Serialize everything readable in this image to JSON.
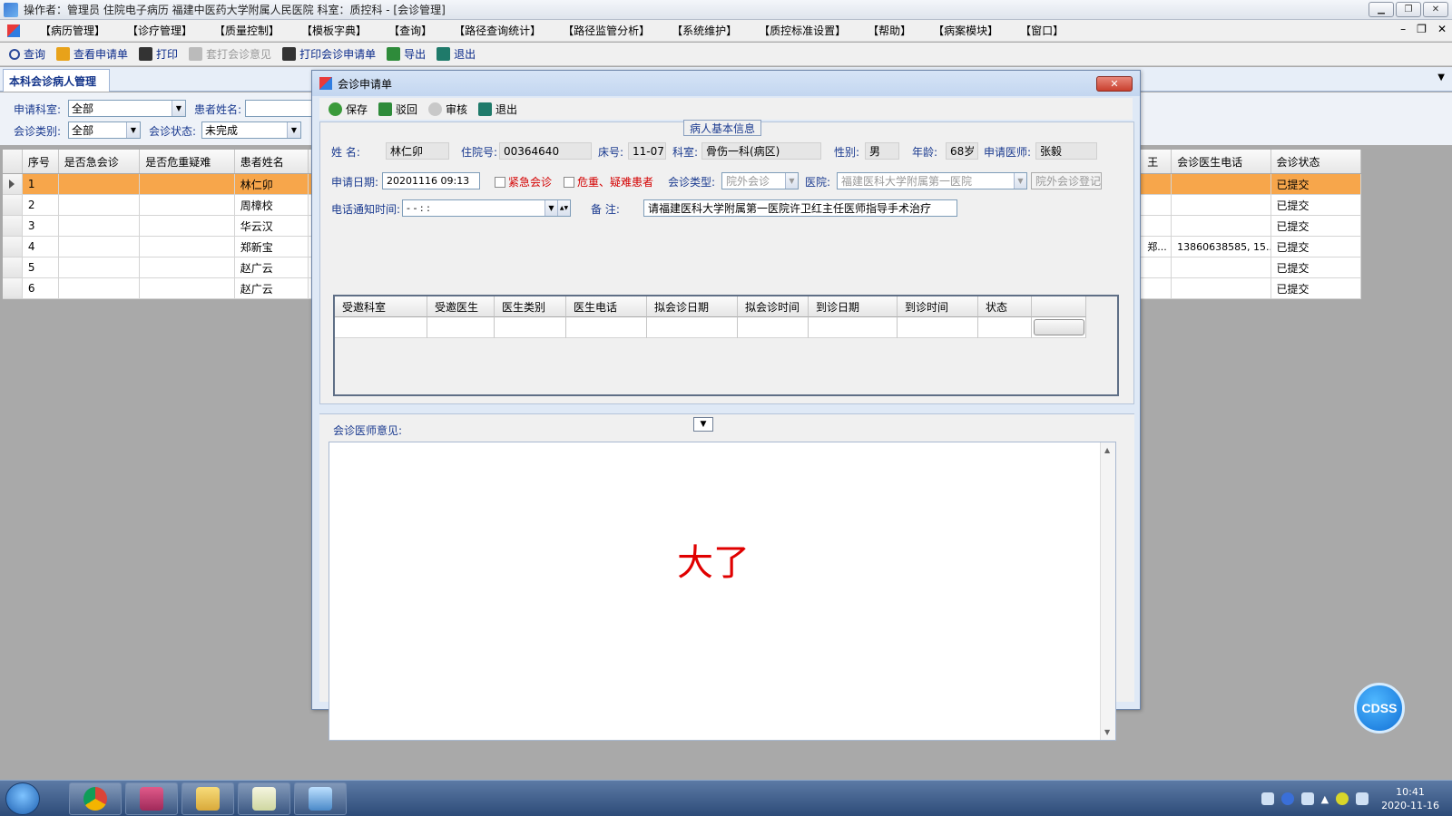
{
  "window": {
    "title": "操作者：管理员 住院电子病历  福建中医药大学附属人民医院  科室：质控科 - [会诊管理]",
    "controls": [
      "▁",
      "❐",
      "✕"
    ]
  },
  "menu": {
    "items": [
      "【病历管理】",
      "【诊疗管理】",
      "【质量控制】",
      "【模板字典】",
      "【查询】",
      "【路径查询统计】",
      "【路径监管分析】",
      "【系统维护】",
      "【质控标准设置】",
      "【帮助】",
      "【病案模块】",
      "【窗口】"
    ],
    "mdi_controls": [
      "–",
      "❐",
      "✕"
    ]
  },
  "toolbar": {
    "items": [
      {
        "label": "查询",
        "icon": "search-icon",
        "color": "#2a4a9a",
        "disabled": false
      },
      {
        "label": "查看申请单",
        "icon": "form-icon",
        "color": "#e8a21a",
        "disabled": false
      },
      {
        "label": "打印",
        "icon": "printer-icon",
        "color": "#333333",
        "disabled": false
      },
      {
        "label": "套打会诊意见",
        "icon": "printer-icon",
        "color": "#9a9a9a",
        "disabled": true
      },
      {
        "label": "打印会诊申请单",
        "icon": "printer-icon",
        "color": "#333333",
        "disabled": false
      },
      {
        "label": "导出",
        "icon": "export-icon",
        "color": "#2e8b3a",
        "disabled": false
      },
      {
        "label": "退出",
        "icon": "exit-icon",
        "color": "#1f7a6a",
        "disabled": false
      }
    ]
  },
  "panel": {
    "tab_label": "本科会诊病人管理",
    "filters": {
      "dept_label": "申请科室:",
      "dept_value": "全部",
      "patient_label": "患者姓名:",
      "type_label": "会诊类别:",
      "type_value": "全部",
      "status_label": "会诊状态:",
      "status_value": "未完成"
    }
  },
  "grid": {
    "columns": [
      "序号",
      "是否急会诊",
      "是否危重疑难",
      "患者姓名"
    ],
    "right_columns": [
      "王",
      "会诊医生电话",
      "会诊状态"
    ],
    "rows": [
      {
        "no": "1",
        "urgent": "",
        "critical": "",
        "name": "林仁卯",
        "extra": "",
        "phone": "",
        "status": "已提交"
      },
      {
        "no": "2",
        "urgent": "",
        "critical": "",
        "name": "周樟校",
        "extra": "",
        "phone": "",
        "status": "已提交"
      },
      {
        "no": "3",
        "urgent": "",
        "critical": "",
        "name": "华云汉",
        "extra": "",
        "phone": "",
        "status": "已提交"
      },
      {
        "no": "4",
        "urgent": "",
        "critical": "",
        "name": "郑新宝",
        "extra": "郑...",
        "phone": "13860638585, 15...",
        "status": "已提交"
      },
      {
        "no": "5",
        "urgent": "",
        "critical": "",
        "name": "赵广云",
        "extra": "",
        "phone": "",
        "status": "已提交"
      },
      {
        "no": "6",
        "urgent": "",
        "critical": "",
        "name": "赵广云",
        "extra": "",
        "phone": "",
        "status": "已提交"
      }
    ]
  },
  "dialog": {
    "title": "会诊申请单",
    "close_label": "✕",
    "toolbar": [
      {
        "label": "保存",
        "icon": "save-icon",
        "color": "#3a9a3a",
        "disabled": false
      },
      {
        "label": "驳回",
        "icon": "reject-icon",
        "color": "#2e8b3a",
        "disabled": false
      },
      {
        "label": "审核",
        "icon": "approve-icon",
        "color": "#9a9a9a",
        "disabled": true
      },
      {
        "label": "退出",
        "icon": "exit-icon",
        "color": "#1f7a6a",
        "disabled": false
      }
    ],
    "section_title": "病人基本信息",
    "patient": {
      "name_label": "姓    名:",
      "name": "林仁卯",
      "inpatient_no_label": "住院号:",
      "inpatient_no": "00364640",
      "bed_label": "床号:",
      "bed": "11-07",
      "dept_label": "科室:",
      "dept": "骨伤一科(病区)",
      "gender_label": "性别:",
      "gender": "男",
      "age_label": "年龄:",
      "age": "68岁",
      "doctor_label": "申请医师:",
      "doctor": "张毅"
    },
    "request": {
      "date_label": "申请日期:",
      "date": "20201116  09:13",
      "urgent_label": "紧急会诊",
      "critical_label": "危重、疑难患者",
      "type_label": "会诊类型:",
      "type_value": "院外会诊",
      "hospital_label": "医院:",
      "hospital_value": "福建医科大学附属第一医院",
      "register_button": "院外会诊登记",
      "phone_time_label": "电话通知时间:",
      "phone_time_value": "  -    -              :      :",
      "note_label": "备      注:",
      "note_value": "请福建医科大学附属第一医院许卫红主任医师指导手术治疗"
    },
    "sub_grid": {
      "columns": [
        "受邀科室",
        "受邀医生",
        "医生类别",
        "医生电话",
        "拟会诊日期",
        "拟会诊时间",
        "到诊日期",
        "到诊时间",
        "状态",
        ""
      ]
    },
    "opinion": {
      "label": "会诊医师意见:",
      "text": "大了"
    }
  },
  "cdss": {
    "label": "CDSS"
  },
  "taskbar": {
    "apps": [
      "chrome-icon",
      "database-icon",
      "folder-icon",
      "chart-icon",
      "medical-app-icon"
    ],
    "time": "10:41",
    "date": "2020-11-16"
  }
}
